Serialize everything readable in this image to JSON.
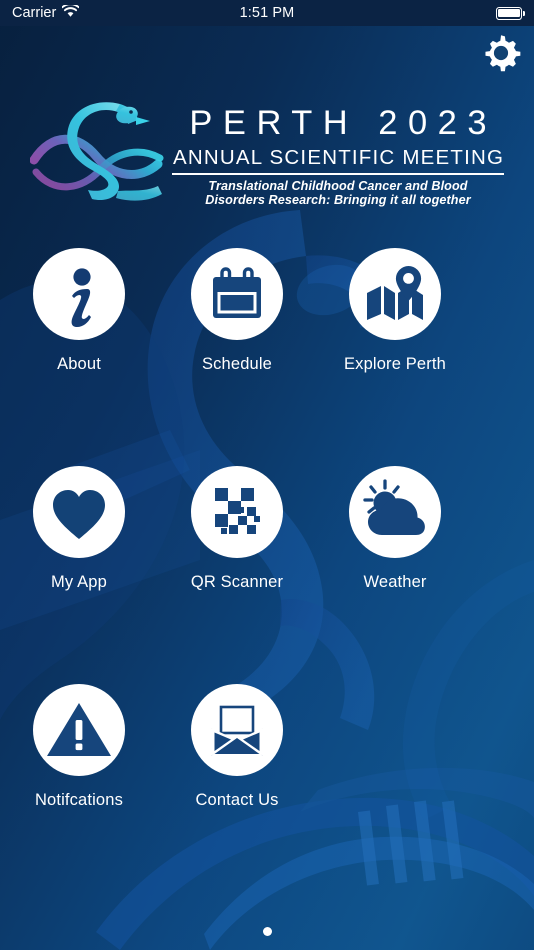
{
  "status_bar": {
    "carrier": "Carrier",
    "wifi_icon": "wifi-icon",
    "time": "1:51 PM",
    "battery_icon": "battery-full-icon"
  },
  "header": {
    "settings_icon": "gear-icon"
  },
  "logo": {
    "mark_icon": "swan-dna-helix-logo",
    "title": "PERTH 2023",
    "subtitle": "ANNUAL SCIENTIFIC MEETING",
    "tagline_line1": "Translational Childhood Cancer and Blood",
    "tagline_line2": "Disorders Research: Bringing it all together"
  },
  "grid": {
    "tiles": [
      {
        "label": "About",
        "icon": "info-icon"
      },
      {
        "label": "Schedule",
        "icon": "calendar-icon"
      },
      {
        "label": "Explore Perth",
        "icon": "map-pin-icon"
      },
      {
        "label": "My App",
        "icon": "heart-icon"
      },
      {
        "label": "QR Scanner",
        "icon": "qr-code-icon"
      },
      {
        "label": "Weather",
        "icon": "sun-cloud-icon"
      },
      {
        "label": "Notifcations",
        "icon": "warning-triangle-icon"
      },
      {
        "label": "Contact Us",
        "icon": "envelope-icon"
      }
    ]
  },
  "pagination": {
    "pages": 1,
    "current_page": 1
  },
  "colors": {
    "background_dark": "#07203e",
    "background_light": "#10568f",
    "icon_circle": "#ffffff",
    "icon_glyph": "#0f4c86",
    "text": "#ffffff",
    "logo_gradient_start": "#8e4fa8",
    "logo_gradient_end": "#36c6e0"
  }
}
